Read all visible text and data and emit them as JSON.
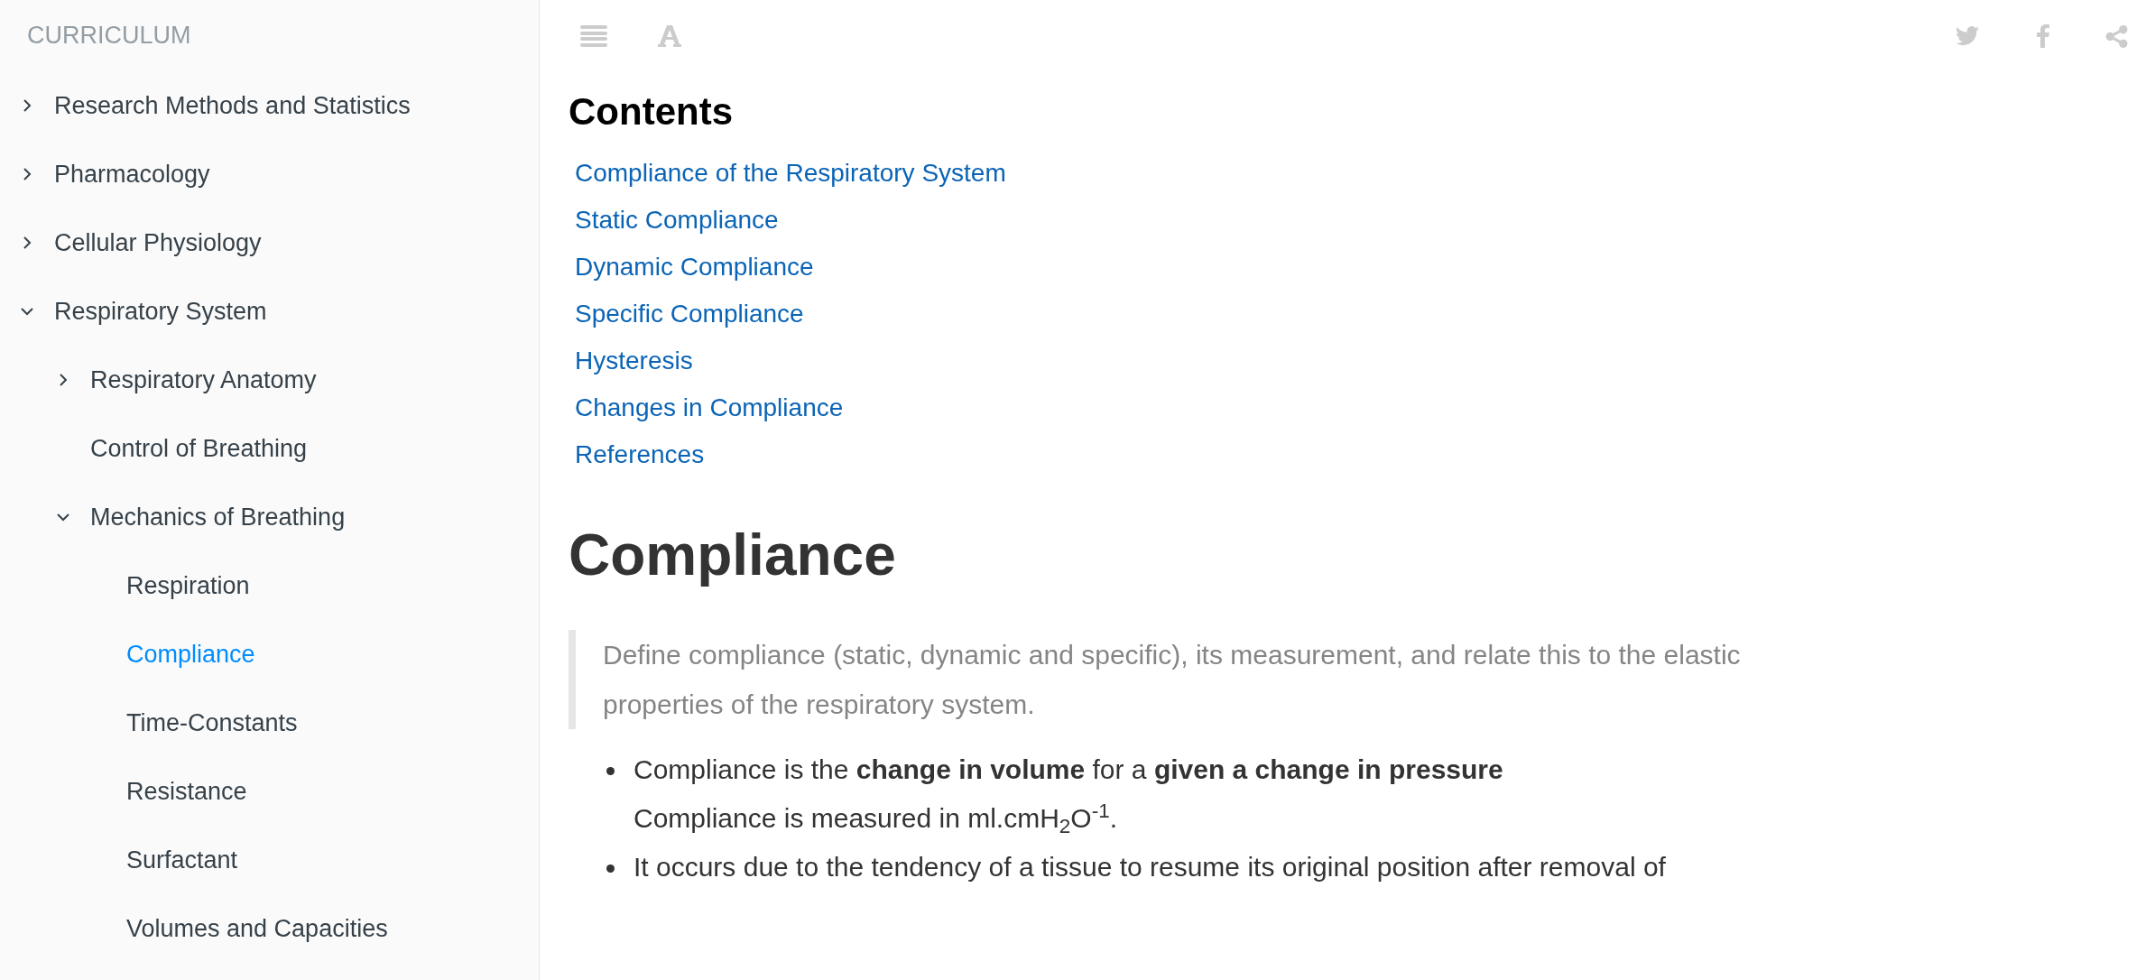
{
  "sidebar": {
    "title": "CURRICULUM",
    "items": [
      {
        "label": "Research Methods and Statistics",
        "expanded": false,
        "selected": false
      },
      {
        "label": "Pharmacology",
        "expanded": false,
        "selected": false
      },
      {
        "label": "Cellular Physiology",
        "expanded": false,
        "selected": false
      },
      {
        "label": "Respiratory System",
        "expanded": true,
        "selected": false,
        "children": [
          {
            "label": "Respiratory Anatomy",
            "expanded": false,
            "selected": false
          },
          {
            "label": "Control of Breathing",
            "selected": false
          },
          {
            "label": "Mechanics of Breathing",
            "expanded": true,
            "selected": false,
            "children": [
              {
                "label": "Respiration",
                "selected": false
              },
              {
                "label": "Compliance",
                "selected": true
              },
              {
                "label": "Time-Constants",
                "selected": false
              },
              {
                "label": "Resistance",
                "selected": false
              },
              {
                "label": "Surfactant",
                "selected": false
              },
              {
                "label": "Volumes and Capacities",
                "selected": false
              }
            ]
          }
        ]
      }
    ]
  },
  "contents": {
    "heading": "Contents",
    "links": [
      "Compliance of the Respiratory System",
      "Static Compliance",
      "Dynamic Compliance",
      "Specific Compliance",
      "Hysteresis",
      "Changes in Compliance",
      "References"
    ]
  },
  "article": {
    "title": "Compliance",
    "objective": "Define compliance (static, dynamic and specific), its measurement, and relate this to the elastic properties of the respiratory system.",
    "bullets": [
      {
        "lines": [
          "Compliance is the **change in volume** for a **given a change in pressure**",
          "Compliance is measured in ml.cmH$_{2}$O$^{-1}$."
        ]
      },
      {
        "lines": [
          "It occurs due to the tendency of a tissue to resume its original position after removal of"
        ]
      }
    ]
  }
}
